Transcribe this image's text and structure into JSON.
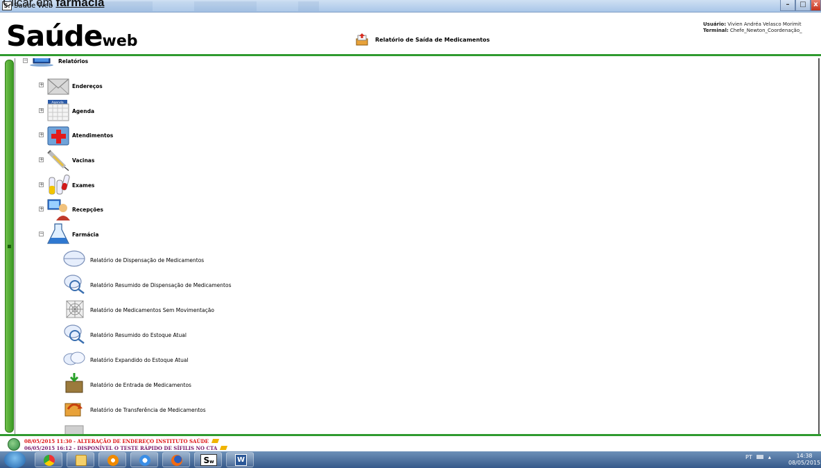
{
  "caption": {
    "prefix": "Clicar em ",
    "target": "farmácia"
  },
  "window": {
    "app_icon": "S.",
    "title": "Saúde Web",
    "min": "–",
    "max": "□",
    "close": "x"
  },
  "header": {
    "logo_main": "Saúde",
    "logo_small": "web",
    "page_title": "Relatório de Saída de Medicamentos",
    "user_label": "Usuário:",
    "user_value": "Vivien Andréa Velasco Morimit",
    "terminal_label": "Terminal:",
    "terminal_value": "Chefe_Newton_Coordenação_"
  },
  "tree": {
    "root": {
      "label": "Relatórios",
      "expander": "−",
      "icon": "monitor-icon"
    },
    "categories": [
      {
        "label": "Endereços",
        "expander": "+",
        "icon": "envelope-icon"
      },
      {
        "label": "Agenda",
        "expander": "+",
        "icon": "calendar-icon",
        "icon_text": "Agenda"
      },
      {
        "label": "Atendimentos",
        "expander": "+",
        "icon": "medical-folder-icon"
      },
      {
        "label": "Vacinas",
        "expander": "+",
        "icon": "syringe-icon"
      },
      {
        "label": "Exames",
        "expander": "+",
        "icon": "test-tubes-icon"
      },
      {
        "label": "Recepções",
        "expander": "+",
        "icon": "reception-icon"
      },
      {
        "label": "Farmácia",
        "expander": "−",
        "icon": "flask-icon"
      }
    ],
    "pharmacy_items": [
      {
        "label": "Relatório de Dispensação de Medicamentos",
        "icon": "pill-icon"
      },
      {
        "label": "Relatório Resumido de Dispensação de Medicamentos",
        "icon": "pill-zoom-icon"
      },
      {
        "label": "Relatório de Medicamentos Sem Movimentação",
        "icon": "spiderweb-icon"
      },
      {
        "label": "Relatório Resumido do Estoque Atual",
        "icon": "pill-zoom-icon"
      },
      {
        "label": "Relatório Expandido do Estoque Atual",
        "icon": "pills-icon"
      },
      {
        "label": "Relatório de Entrada de Medicamentos",
        "icon": "box-in-icon"
      },
      {
        "label": "Relatório de Transferência de Medicamentos",
        "icon": "transfer-icon"
      }
    ]
  },
  "news": [
    {
      "text": "08/05/2015 11:30 - ALTERAÇÃO DE ENDEREÇO INSTITUTO SAÚDE"
    },
    {
      "text": "06/05/2015 16:12 - DISPONÍVEL O TESTE RÁPIDO DE SÍFILIS NO CTA"
    }
  ],
  "taskbar": {
    "apps": [
      "chrome-icon",
      "explorer-folder-icon",
      "media-player-icon",
      "internet-explorer-icon",
      "firefox-icon",
      "saude-web-icon",
      "word-icon"
    ],
    "saude_label": "S",
    "saude_sub": "w",
    "word_label": "W",
    "lang": "PT",
    "time": "14:38",
    "date": "08/05/2015"
  },
  "colors": {
    "accent_green": "#2f9a2f",
    "news_red": "#dd1111",
    "news_purple": "#7a1a6a"
  }
}
